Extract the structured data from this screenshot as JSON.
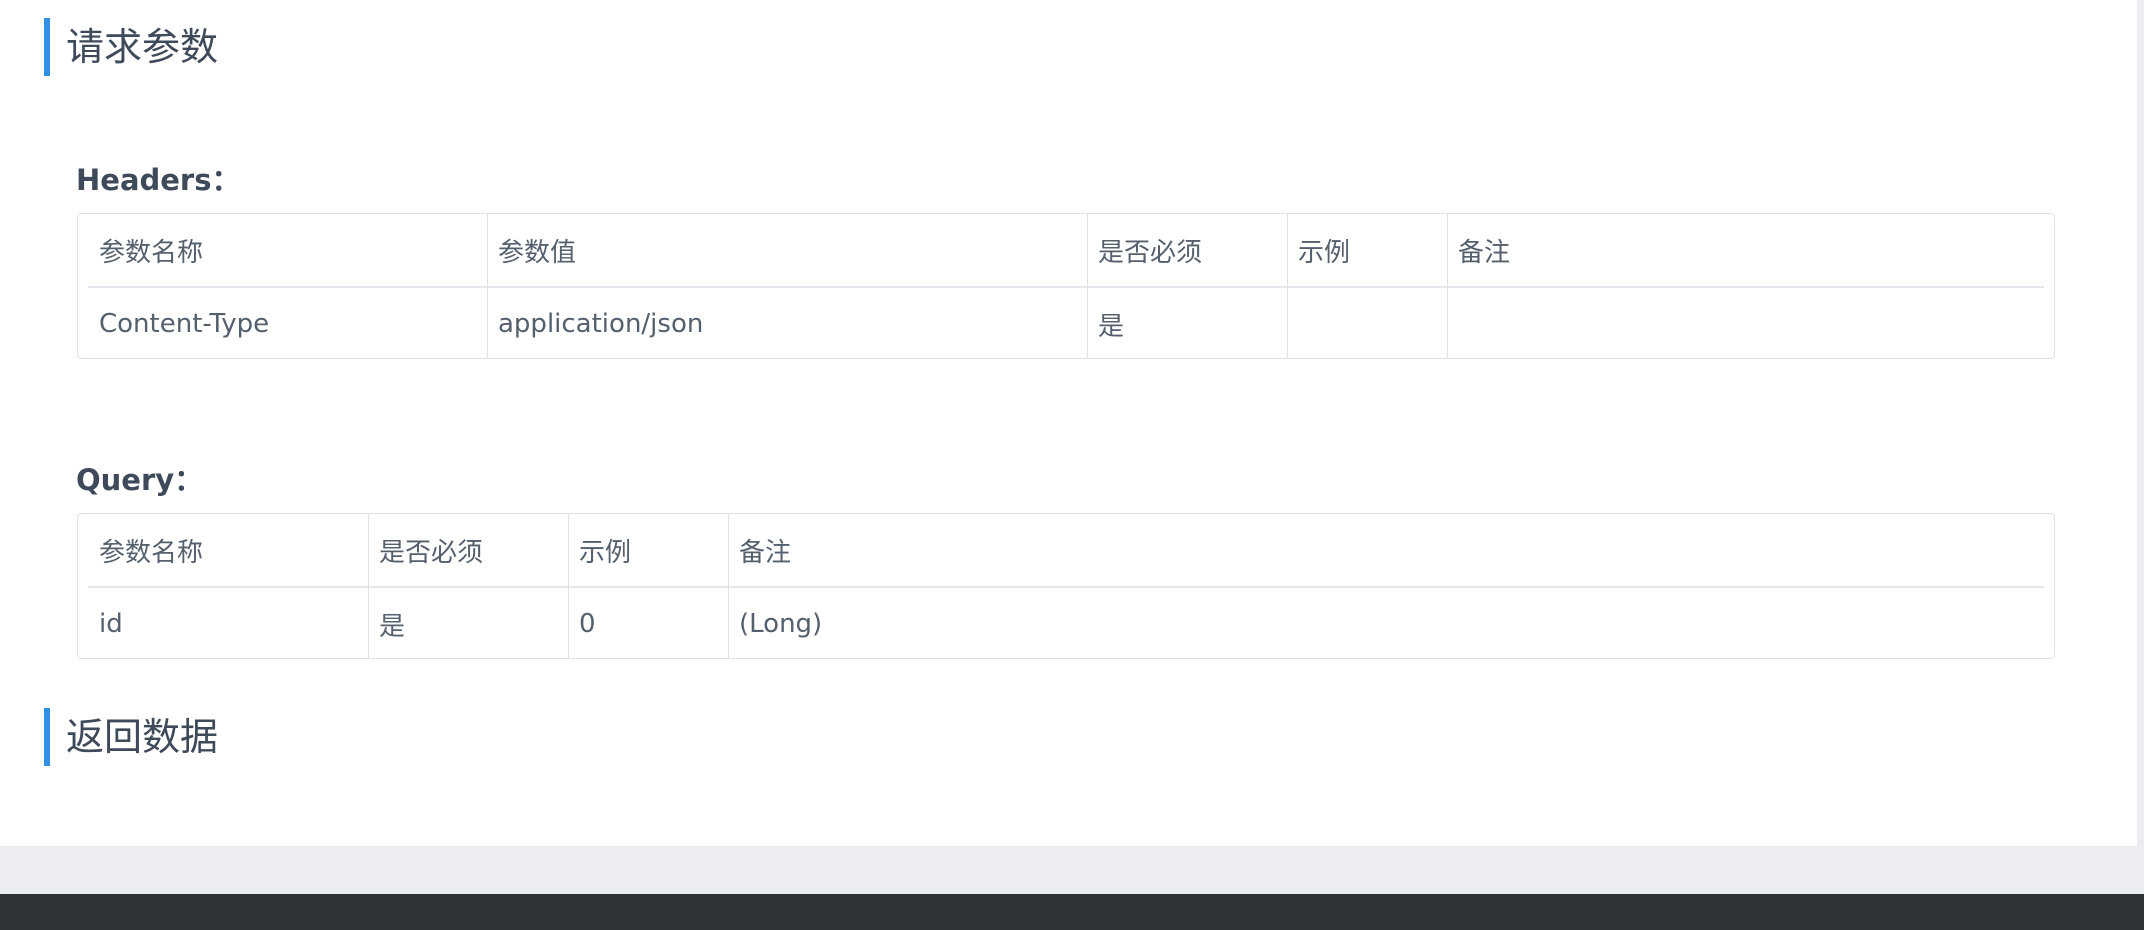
{
  "request_section": {
    "title": "请求参数"
  },
  "headers": {
    "label": "Headers：",
    "columns": [
      "参数名称",
      "参数值",
      "是否必须",
      "示例",
      "备注"
    ],
    "rows": [
      [
        "Content-Type",
        "application/json",
        "是",
        "",
        ""
      ]
    ]
  },
  "query": {
    "label": "Query：",
    "columns": [
      "参数名称",
      "是否必须",
      "示例",
      "备注"
    ],
    "rows": [
      [
        "id",
        "是",
        "0",
        "(Long)"
      ]
    ]
  },
  "response_section": {
    "title": "返回数据"
  },
  "colors": {
    "accent": "#2f90e8",
    "footer": "#303337",
    "background": "#ecedf1"
  }
}
